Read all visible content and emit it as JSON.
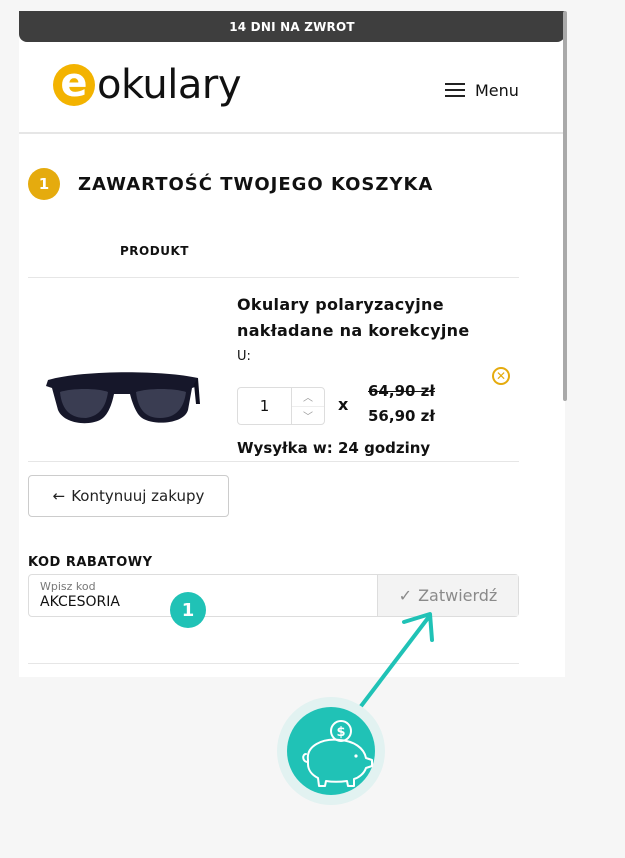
{
  "topbar": {
    "text": "14 DNI NA ZWROT"
  },
  "header": {
    "logo_letter": "e",
    "logo_text": "okulary",
    "menu_label": "Menu"
  },
  "cart": {
    "step": "1",
    "title": "ZAWARTOŚĆ TWOJEGO KOSZYKA",
    "column_product": "PRODUKT",
    "item": {
      "name": "Okulary polaryzacyjne nakładane na korekcyjne",
      "variant": "U:",
      "quantity": "1",
      "times": "x",
      "old_price": "64,90 zł",
      "new_price": "56,90 zł",
      "shipping": "Wysyłka w: 24 godziny"
    },
    "continue_label": "Kontynuuj zakupy",
    "continue_arrow": "←"
  },
  "coupon": {
    "label": "KOD RABATOWY",
    "placeholder": "Wpisz kod",
    "value": "AKCESORIA",
    "apply_label": "Zatwierdź",
    "apply_check": "✓"
  },
  "annotation": {
    "marker": "1",
    "accent": "#20c2b6"
  },
  "colors": {
    "brand_yellow": "#f3b300",
    "step_yellow": "#e5ab0e",
    "topbar": "#3e3e3e"
  }
}
